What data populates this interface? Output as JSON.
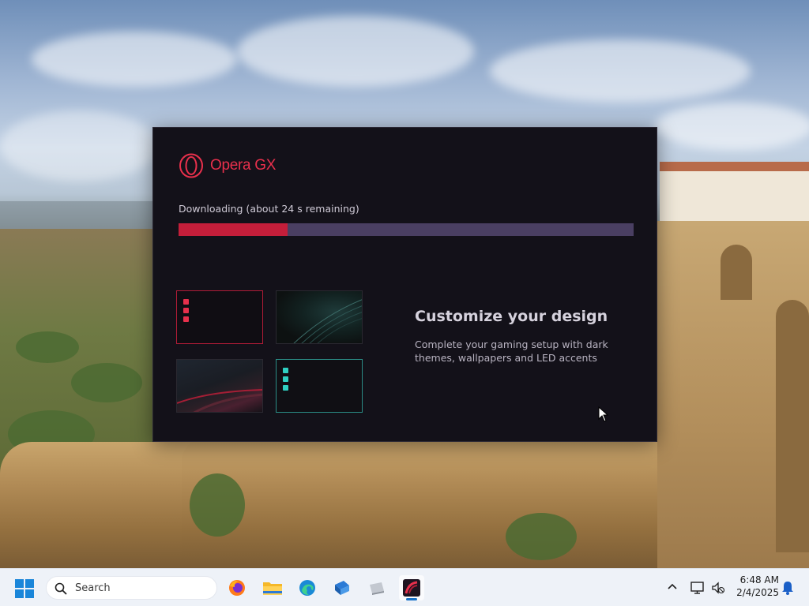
{
  "installer": {
    "brand_name": "Opera GX",
    "status_text": "Downloading (about 24 s remaining)",
    "progress": 0.24,
    "feature_title": "Customize your design",
    "feature_description": "Complete your gaming setup with dark themes, wallpapers and LED accents",
    "colors": {
      "accent": "#e8304c",
      "progress_fill": "#c41e3a",
      "progress_track": "#4a3f62",
      "background": "#131119",
      "teal_accent": "#2fd0c2"
    },
    "thumbnails": [
      "red-led-theme",
      "wave-wallpaper",
      "car-wallpaper",
      "teal-led-theme"
    ]
  },
  "taskbar": {
    "search_placeholder": "Search",
    "apps": [
      {
        "name": "firefox-icon"
      },
      {
        "name": "file-explorer-icon"
      },
      {
        "name": "edge-icon"
      },
      {
        "name": "blue-app-icon"
      },
      {
        "name": "gray-app-icon"
      },
      {
        "name": "opera-gx-installer-icon",
        "active": true
      }
    ],
    "clock": {
      "time": "6:48 AM",
      "date": "2/4/2025"
    }
  }
}
